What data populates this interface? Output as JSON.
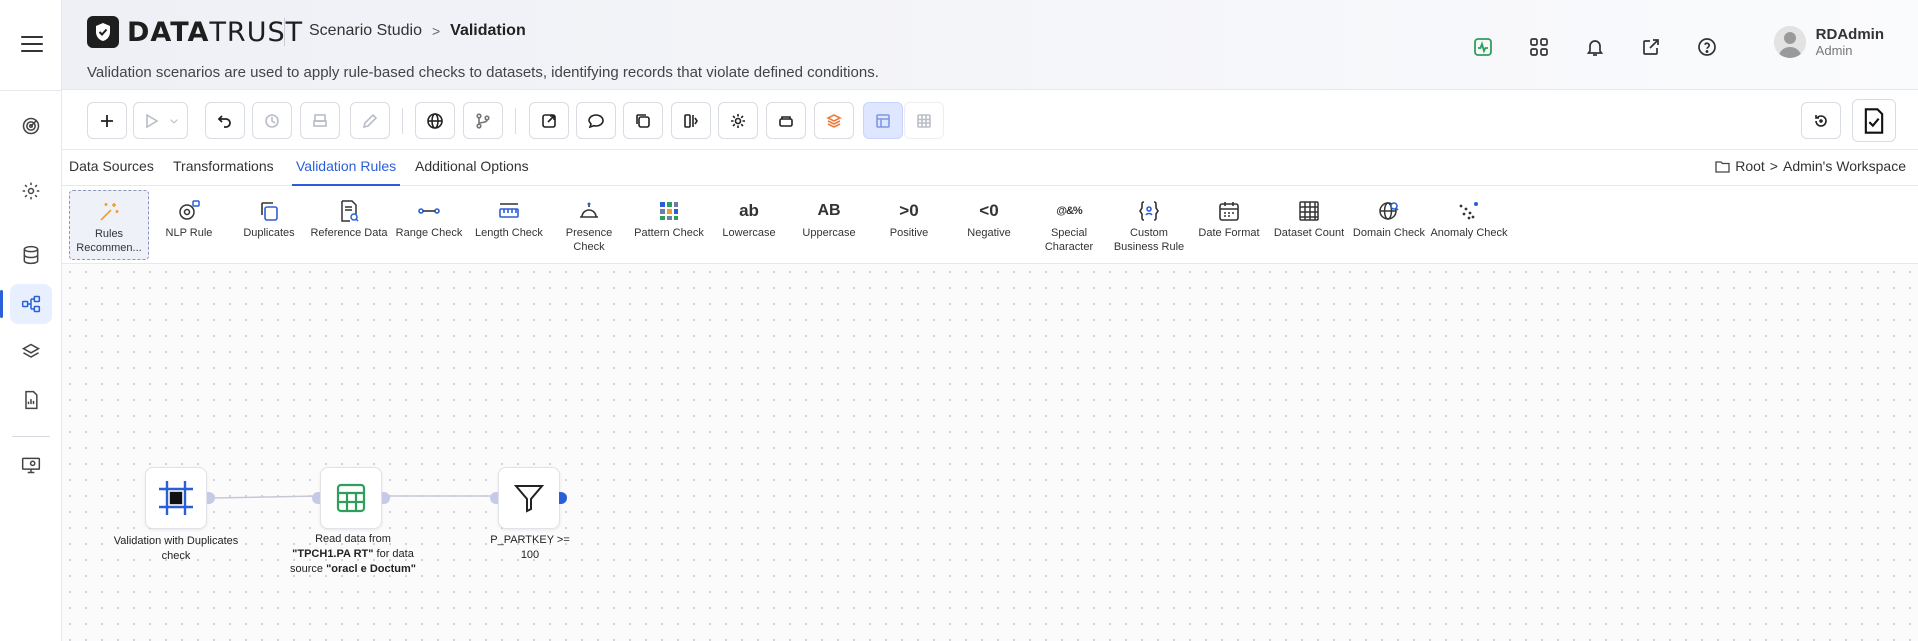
{
  "header": {
    "logo_bold": "DATA",
    "logo_light": "TRUST",
    "breadcrumb_parent": "Scenario Studio",
    "breadcrumb_sep": ">",
    "breadcrumb_current": "Validation",
    "description": "Validation scenarios are used to apply rule-based checks to datasets, identifying records that violate defined conditions.",
    "user_name": "RDAdmin",
    "user_role": "Admin"
  },
  "tabs": [
    {
      "label": "Data Sources"
    },
    {
      "label": "Transformations"
    },
    {
      "label": "Validation Rules",
      "active": true
    },
    {
      "label": "Additional Options"
    }
  ],
  "workspace": {
    "root": "Root",
    "sep": ">",
    "current": "Admin's Workspace"
  },
  "palette": [
    {
      "label": "Rules Recommen...",
      "icon": "magic-wand-icon",
      "selected": true
    },
    {
      "label": "NLP Rule",
      "icon": "nlp-icon"
    },
    {
      "label": "Duplicates",
      "icon": "copy-icon"
    },
    {
      "label": "Reference Data",
      "icon": "document-search-icon"
    },
    {
      "label": "Range Check",
      "icon": "range-icon"
    },
    {
      "label": "Length Check",
      "icon": "ruler-icon"
    },
    {
      "label": "Presence Check",
      "icon": "bell-presence-icon"
    },
    {
      "label": "Pattern Check",
      "icon": "pattern-grid-icon"
    },
    {
      "label": "Lowercase",
      "icon": "ab-lower-icon",
      "glyph": "ab"
    },
    {
      "label": "Uppercase",
      "icon": "ab-upper-icon",
      "glyph": "AB"
    },
    {
      "label": "Positive",
      "icon": "gt-zero-icon",
      "glyph": ">0"
    },
    {
      "label": "Negative",
      "icon": "lt-zero-icon",
      "glyph": "<0"
    },
    {
      "label": "Special Character",
      "icon": "special-char-icon",
      "glyph": "@&%"
    },
    {
      "label": "Custom Business Rule",
      "icon": "braces-icon"
    },
    {
      "label": "Date Format",
      "icon": "calendar-icon"
    },
    {
      "label": "Dataset Count",
      "icon": "table-count-icon"
    },
    {
      "label": "Domain Check",
      "icon": "globe-search-icon"
    },
    {
      "label": "Anomaly Check",
      "icon": "anomaly-dots-icon"
    }
  ],
  "nodes": [
    {
      "label": "Validation with Duplicates check",
      "icon": "frame-icon"
    },
    {
      "label_parts": [
        "Read data from ",
        "\"TPCH1.PA RT\"",
        " for data source ",
        "\"oracl e Doctum\""
      ],
      "icon": "table-icon"
    },
    {
      "label": "P_PARTKEY >= 100",
      "icon": "filter-icon"
    }
  ],
  "colors": {
    "accent": "#2b5fd9",
    "active_tab": "#2b5fd9",
    "activity_green": "#2e9e5b",
    "node_table_green": "#2e9e5b",
    "node_frame_blue": "#2b5fd9"
  }
}
